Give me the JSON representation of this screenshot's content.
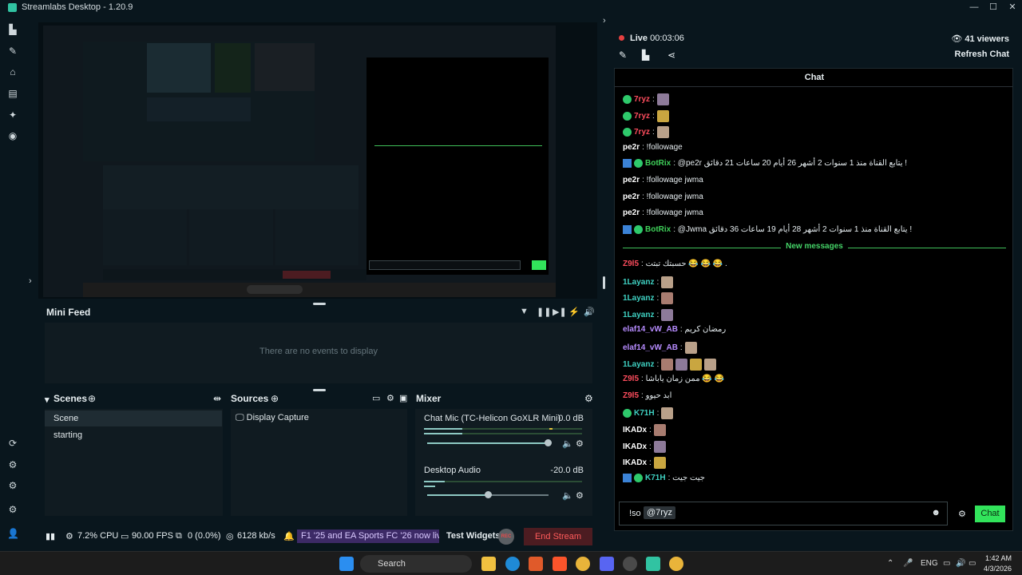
{
  "window": {
    "title": "Streamlabs Desktop - 1.20.9"
  },
  "mini_feed": {
    "title": "Mini Feed",
    "empty_text": "There are no events to display"
  },
  "scenes": {
    "title": "Scenes",
    "items": [
      "Scene",
      "starting"
    ]
  },
  "sources": {
    "title": "Sources",
    "items": [
      "Display Capture"
    ]
  },
  "mixer": {
    "title": "Mixer",
    "channels": [
      {
        "name": "Chat Mic (TC-Helicon GoXLR Mini)",
        "db": "0.0 dB"
      },
      {
        "name": "Desktop Audio",
        "db": "-20.0 dB"
      }
    ]
  },
  "status": {
    "cpu": "7.2% CPU",
    "fps": "90.00 FPS",
    "dropped": "0 (0.0%)",
    "bitrate": "6128 kb/s",
    "ticker": "F1 '25 and EA Sports FC '26 now live in Hi",
    "test_widgets": "Test Widgets",
    "rec": "REC",
    "end_stream": "End Stream"
  },
  "live": {
    "label": "Live",
    "time": "00:03:06",
    "viewers": "41 viewers",
    "refresh": "Refresh Chat"
  },
  "chat": {
    "title": "Chat",
    "new_messages": "New messages",
    "messages": [
      {
        "user": "7ryz",
        "color": "#ff4d5e",
        "text": ":",
        "badges": [
          "v"
        ],
        "emotes": 1
      },
      {
        "user": "7ryz",
        "color": "#ff4d5e",
        "text": ":",
        "badges": [
          "v"
        ],
        "emotes": 1
      },
      {
        "user": "7ryz",
        "color": "#ff4d5e",
        "text": ":",
        "badges": [
          "v"
        ],
        "emotes": 1
      },
      {
        "user": "pe2r",
        "color": "#ffffff",
        "text": ": !followage",
        "badges": [],
        "emotes": 0
      },
      {
        "user": "BotRix",
        "color": "#3fd15a",
        "text": ": @pe2r يتابع القناة منذ 1 سنوات 2 أشهر 26 أيام 20 ساعات 21 دقائق !",
        "badges": [
          "b",
          "v"
        ],
        "emotes": 0
      },
      {
        "user": "pe2r",
        "color": "#ffffff",
        "text": ": !followage jwma",
        "badges": [],
        "emotes": 0
      },
      {
        "user": "pe2r",
        "color": "#ffffff",
        "text": ": !followage jwma",
        "badges": [],
        "emotes": 0
      },
      {
        "user": "pe2r",
        "color": "#ffffff",
        "text": ": !followage jwma",
        "badges": [],
        "emotes": 0
      },
      {
        "user": "BotRix",
        "color": "#3fd15a",
        "text": ": @Jwma يتابع القناة منذ 1 سنوات 2 أشهر 28 أيام 19 ساعات 36 دقائق !",
        "badges": [
          "b",
          "v"
        ],
        "emotes": 0
      },
      {
        "user": "Z9l5",
        "color": "#ff4d5e",
        "text": ": حسبتك تبتت 😂 😂 😂 .",
        "badges": [],
        "emotes": 0
      },
      {
        "user": "1Layanz",
        "color": "#3fd1c2",
        "text": ":",
        "badges": [],
        "emotes": 1
      },
      {
        "user": "1Layanz",
        "color": "#3fd1c2",
        "text": ":",
        "badges": [],
        "emotes": 1
      },
      {
        "user": "1Layanz",
        "color": "#3fd1c2",
        "text": ":",
        "badges": [],
        "emotes": 1
      },
      {
        "user": "elaf14_vW_AB",
        "color": "#b78cff",
        "text": ": رمضان كريم",
        "badges": [],
        "emotes": 0
      },
      {
        "user": "elaf14_vW_AB",
        "color": "#b78cff",
        "text": ":",
        "badges": [],
        "emotes": 1
      },
      {
        "user": "1Layanz",
        "color": "#3fd1c2",
        "text": ":",
        "badges": [],
        "emotes": 4
      },
      {
        "user": "Z9l5",
        "color": "#ff4d5e",
        "text": ": ممن زمان ياباشا 😂 😂",
        "badges": [],
        "emotes": 0
      },
      {
        "user": "Z9l5",
        "color": "#ff4d5e",
        "text": ": ابد حيوو",
        "badges": [],
        "emotes": 0
      },
      {
        "user": "K71H",
        "color": "#3fd1c2",
        "text": ":",
        "badges": [
          "v"
        ],
        "emotes": 1
      },
      {
        "user": "IKADx",
        "color": "#ffffff",
        "text": ":",
        "badges": [],
        "emotes": 1
      },
      {
        "user": "IKADx",
        "color": "#ffffff",
        "text": ":",
        "badges": [],
        "emotes": 1
      },
      {
        "user": "IKADx",
        "color": "#ffffff",
        "text": ":",
        "badges": [],
        "emotes": 1
      },
      {
        "user": "K71H",
        "color": "#3fd1c2",
        "text": ": جيت جيت",
        "badges": [
          "b",
          "v"
        ],
        "emotes": 0
      }
    ],
    "input_prefix": "!so",
    "input_mention": "@7ryz",
    "send": "Chat"
  },
  "taskbar": {
    "search": "Search",
    "lang": "ENG",
    "time": "1:42 AM",
    "date": "4/3/2026"
  },
  "colors": {
    "accent": "#31c3a2",
    "live": "#e64040",
    "chat_button": "#32e35b",
    "new_messages": "#45d468",
    "end_stream_bg": "#4c1c21"
  }
}
